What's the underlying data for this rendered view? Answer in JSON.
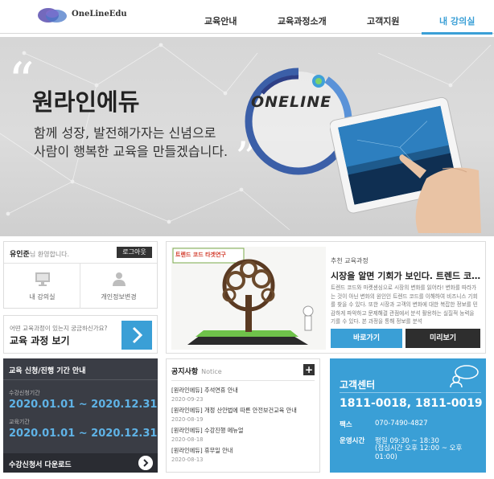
{
  "header": {
    "logo_text": "OneLineEdu",
    "nav": [
      {
        "label": "교육안내"
      },
      {
        "label": "교육과정소개"
      },
      {
        "label": "고객지원"
      },
      {
        "label": "내 강의실",
        "active": true
      }
    ],
    "accent_color": "#3a9fd6"
  },
  "hero": {
    "title": "원라인에듀",
    "subtitle_line1": "함께 성장, 발전해가자는 신념으로",
    "subtitle_line2": "사람이 행복한 교육을 만들겠습니다.",
    "ring_text": "ONELINE"
  },
  "welcome": {
    "user_name": "유인준",
    "greeting": "님 환영합니다.",
    "logout_label": "로그아웃",
    "my_classroom_label": "내 강의실",
    "profile_edit_label": "개인정보변경"
  },
  "course_ask": {
    "question": "어떤 교육과정이 있는지 궁금하신가요?",
    "title": "교육 과정 보기"
  },
  "promo": {
    "image_caption": "트렌드 코드 타겟연구",
    "label": "추천 교육과정",
    "title": "시장을 알면 기회가 보인다. 트렌드 코…",
    "description": "트렌드 코드와 마켓센싱으로 시장의 변화를 읽어라! 변화를 따라가는 것이 아닌 변화의 원인인 트렌드 코드를 이해하여 비즈니스 기회를 찾을 수 있다. 또한 시장과 고객의 변화에 대한 복잡한 정보를 민감하게 파악하고 문제해결 관점에서 분석 활용하는 실질적 능력을 기를 수 있다. 본 과정을 통해 정보를 분석",
    "go_label": "바로가기",
    "preview_label": "미리보기"
  },
  "period": {
    "title": "교육 신청/진행 기간 안내",
    "apply_label": "수강신청기간",
    "apply_value": "2020.01.01 ~ 2020.12.31",
    "course_label": "교육기간",
    "course_value": "2020.01.01 ~ 2020.12.31",
    "download_label": "수강신청서 다운로드"
  },
  "notice": {
    "title": "공지사항",
    "title_en": "Notice",
    "items": [
      {
        "title": "[원라인에듀] 추석연휴 안내",
        "date": "2020-09-23"
      },
      {
        "title": "[원라인에듀] 개정 산안법에 따른 안전보건교육 안내",
        "date": "2020-08-19"
      },
      {
        "title": "[원라인에듀] 수강진행 메뉴얼",
        "date": "2020-08-18"
      },
      {
        "title": "[원라인에듀] 휴무일 안내",
        "date": "2020-08-13"
      }
    ]
  },
  "customer_center": {
    "title": "고객센터",
    "phone": "1811-0018, 1811-0019",
    "fax_label": "팩스",
    "fax_value": "070-7490-4827",
    "hours_label": "운영시간",
    "hours_value": "평일 09:30 ~ 18:30",
    "hours_lunch": "(점심시간 오후 12:00 ~ 오후 01:00)"
  }
}
